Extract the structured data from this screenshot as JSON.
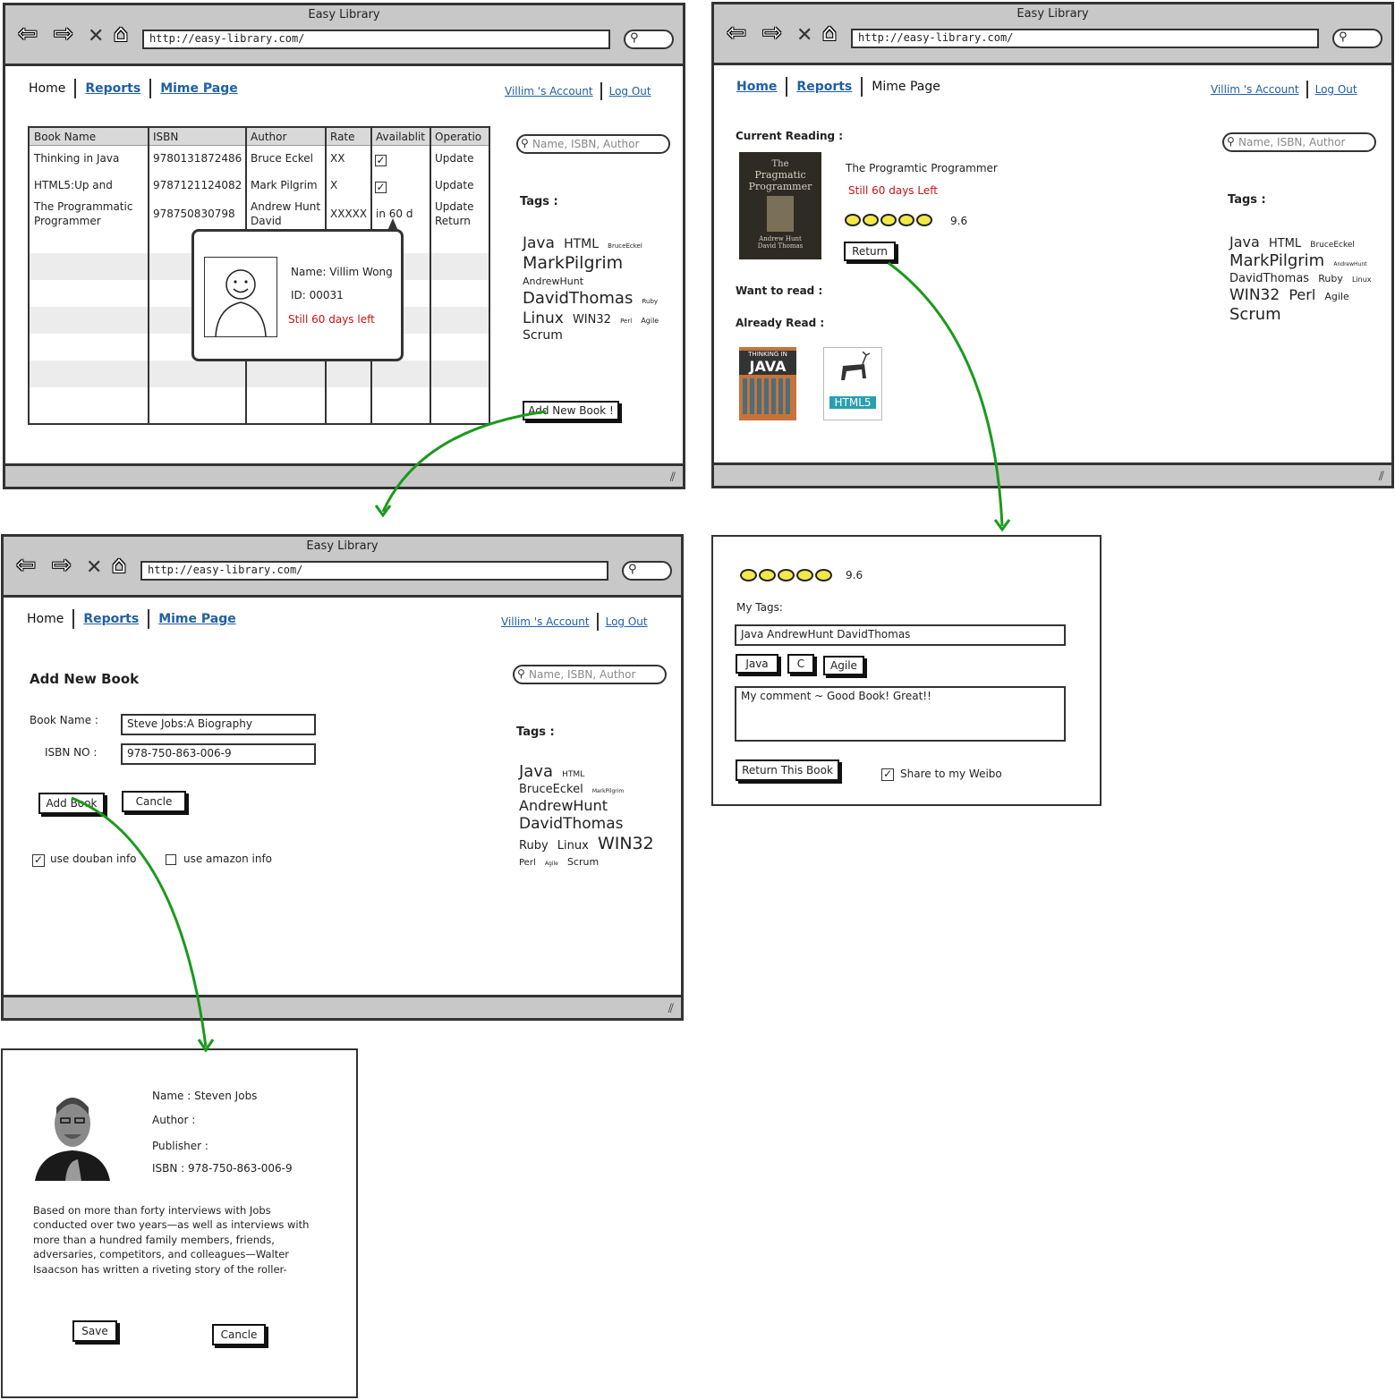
{
  "browser": {
    "title": "Easy Library",
    "url": "http://easy-library.com/"
  },
  "nav": {
    "home": "Home",
    "reports": "Reports",
    "mime": "Mime Page",
    "account": "Villim 's Account",
    "logout": "Log Out"
  },
  "search": {
    "placeholder": "Name, ISBN, Author"
  },
  "tags_label": "Tags :",
  "home_screen": {
    "table": {
      "headers": [
        "Book Name",
        "ISBN",
        "Author",
        "Rate",
        "Availablit",
        "Operatio"
      ],
      "rows": [
        {
          "name": "Thinking in Java",
          "isbn": "9780131872486",
          "author": "Bruce Eckel",
          "rate": "XX",
          "avail": "check",
          "op": "Update"
        },
        {
          "name": "HTML5:Up and",
          "isbn": "9787121124082",
          "author": "Mark Pilgrim",
          "rate": "X",
          "avail": "check",
          "op": "Update"
        },
        {
          "name": "The Programmatic",
          "name2": "Programmer",
          "isbn": "978750830798",
          "author": "Andrew Hunt",
          "author2": "David",
          "rate": "XXXXX",
          "avail": "in 60 d",
          "op": "Update",
          "op2": "Return"
        }
      ]
    },
    "popup": {
      "name": "Name: Villim Wong",
      "id": "ID: 00031",
      "days": "Still 60 days left"
    },
    "tags": [
      "Java",
      "HTML",
      "BruceEckel",
      "MarkPilgrim",
      "AndrewHunt",
      "DavidThomas",
      "Ruby",
      "Linux",
      "WIN32",
      "Perl",
      "Agile",
      "Scrum"
    ],
    "add_button": "Add New Book !"
  },
  "mime_screen": {
    "current_label": "Current Reading :",
    "book_title": "The Programtic Programmer",
    "days_left": "Still 60 days Left",
    "score": "9.6",
    "return_button": "Return",
    "want_label": "Want to read :",
    "already_label": "Already Read :",
    "cover1": {
      "line1": "The",
      "line2": "Pragmatic",
      "line3": "Programmer",
      "authors1": "Andrew Hunt",
      "authors2": "David Thomas"
    },
    "cover2": {
      "text": "THINKING IN",
      "big": "JAVA"
    },
    "cover3": {
      "text": "HTML5"
    },
    "tags": [
      "Java",
      "HTML",
      "BruceEckel",
      "MarkPilgrim",
      "AndrewHunt",
      "DavidThomas",
      "Ruby",
      "Linux",
      "WIN32",
      "Perl",
      "Agile",
      "Scrum"
    ]
  },
  "add_screen": {
    "heading": "Add New Book",
    "name_label": "Book Name :",
    "name_value": "Steve Jobs:A Biography",
    "isbn_label": "ISBN NO :",
    "isbn_value": "978-750-863-006-9",
    "add_button": "Add Book",
    "cancel_button": "Cancle",
    "douban": "use douban info",
    "amazon": "use amazon info",
    "tags": [
      "Java",
      "HTML",
      "BruceEckel",
      "MarkPilgrim",
      "AndrewHunt",
      "DavidThomas",
      "Ruby",
      "Linux",
      "WIN32",
      "Perl",
      "Agile",
      "Scrum"
    ]
  },
  "return_panel": {
    "score": "9.6",
    "my_tags_label": "My Tags:",
    "my_tags_value": "Java AndrewHunt DavidThomas",
    "tag_buttons": [
      "Java",
      "C",
      "Agile"
    ],
    "comment": "My comment ~ Good Book! Great!!",
    "return_button": "Return This Book",
    "share": "Share to my Weibo"
  },
  "detail_panel": {
    "name": "Name : Steven Jobs",
    "author": "Author :",
    "publisher": "Publisher :",
    "isbn": "ISBN : 978-750-863-006-9",
    "desc": [
      "Based on more than forty interviews with Jobs",
      "conducted over two years—as well as interviews with",
      "more than a hundred family members, friends,",
      "adversaries, competitors, and colleagues—Walter",
      "Isaacson has written a riveting story of the roller-"
    ],
    "save_button": "Save",
    "cancel_button": "Cancle"
  },
  "colors": {
    "link": "#1f5fa6",
    "alert": "#cc1111",
    "arrow": "#1a9a1a",
    "frame": "#c8c8c8",
    "star": "#f2e84a"
  }
}
